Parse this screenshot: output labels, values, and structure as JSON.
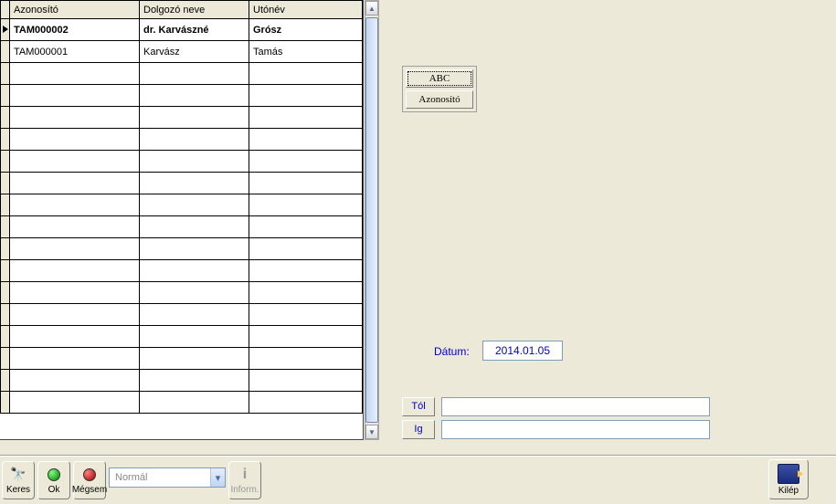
{
  "table": {
    "headers": [
      "Azonosító",
      "Dolgozó neve",
      "Utónév"
    ],
    "rows": [
      {
        "selected": true,
        "cells": [
          "TAM000002",
          "dr. Karvászné",
          "Grósz"
        ]
      },
      {
        "selected": false,
        "cells": [
          "TAM000001",
          "Karvász",
          "Tamás"
        ]
      }
    ],
    "empty_rows": 16
  },
  "right_buttons": {
    "abc": "ABC",
    "azonosito": "Azonosító"
  },
  "datum": {
    "label": "Dátum:",
    "value": "2014.01.05"
  },
  "range": {
    "tol_label": "Tól",
    "tol_value": "",
    "ig_label": "Ig",
    "ig_value": ""
  },
  "toolbar": {
    "keres": "Keres",
    "ok": "Ok",
    "megsem": "Mégsem",
    "combo_value": "Normál",
    "inform": "Inform.",
    "kilep": "Kilép"
  }
}
